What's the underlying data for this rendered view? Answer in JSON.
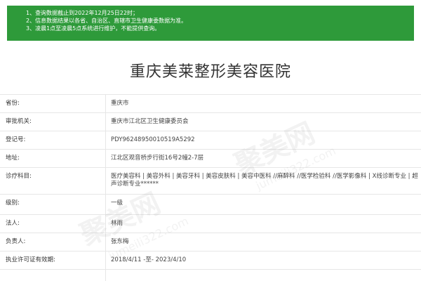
{
  "notice": {
    "lines": [
      "1、查询数据截止到2022年12月25日22时；",
      "2、信息数据结果以各省、自治区、直辖市卫生健康委数据为准。",
      "3、凌晨1点至凌晨5点系统进行维护，不能提供查询。"
    ]
  },
  "title": "重庆美莱整形美容医院",
  "rows": [
    {
      "label": "省份:",
      "value": "重庆市"
    },
    {
      "label": "审批机关:",
      "value": "重庆市江北区卫生健康委员会"
    },
    {
      "label": "登记号:",
      "value": "PDY96248950010519A5292"
    },
    {
      "label": "地址:",
      "value": "江北区观音桥步行街16号2幢2-7层"
    },
    {
      "label": "诊疗科目:",
      "value": "医疗美容科 | 美容外科 | 美容牙科 | 美容皮肤科 | 美容中医科 //麻醉科 //医学检验科 //医学影像科 | X线诊断专业 | 超声诊断专业******"
    },
    {
      "label": "级别:",
      "value": "一级"
    },
    {
      "label": "法人:",
      "value": "林雨"
    },
    {
      "label": "负责人:",
      "value": "张东梅"
    },
    {
      "label": "执业许可证有效期:",
      "value": "2018/4/11 -至- 2023/4/10"
    }
  ],
  "watermark": {
    "text": "聚美网",
    "url": "jumeili322.com"
  },
  "colors": {
    "notice_bg": "#2e9a3a",
    "border": "#e6e6e6"
  }
}
